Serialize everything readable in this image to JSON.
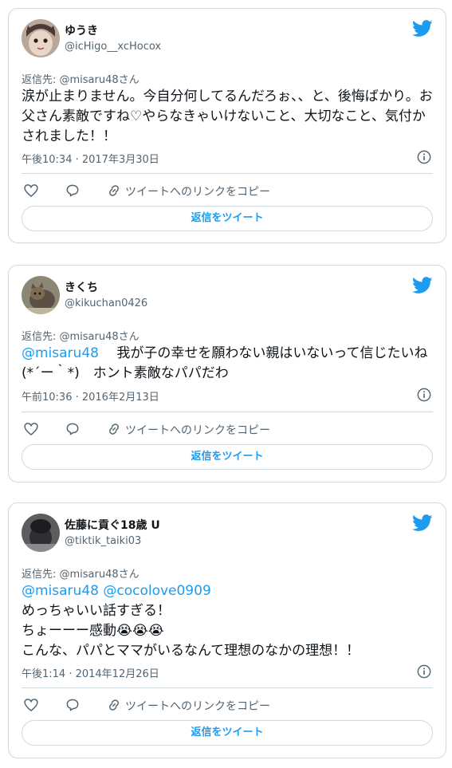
{
  "tweets": [
    {
      "display_name": "ゆうき",
      "handle": "@icHigo__xcHocox",
      "reply_to": "返信先: @misaru48さん",
      "mentions": "",
      "text": "涙が止まりません。今自分何してるんだろぉ、、と、後悔ばかり。お父さん素敵ですね♡やらなきゃいけないこと、大切なこと、気付かされました！！",
      "timestamp": "午後10:34 · 2017年3月30日",
      "copy_link_label": "ツイートへのリンクをコピー",
      "reply_button_label": "返信をツイート"
    },
    {
      "display_name": "きくち",
      "handle": "@kikuchan0426",
      "reply_to": "返信先: @misaru48さん",
      "mentions": "@misaru48",
      "text": "　 我が子の幸せを願わない親はいないって信じたいね(*´ー｀*)　ホント素敵なパパだわ",
      "timestamp": "午前10:36 · 2016年2月13日",
      "copy_link_label": "ツイートへのリンクをコピー",
      "reply_button_label": "返信をツイート"
    },
    {
      "display_name": "佐藤に貢ぐ18歳 U",
      "handle": "@tiktik_taiki03",
      "reply_to": "返信先: @misaru48さん",
      "mentions": "@misaru48 @cocolove0909",
      "text_lines": [
        "めっちゃいい話すぎる！",
        "ちょーーー感動😭😭😭",
        "こんな、パパとママがいるなんて理想のなかの理想！！"
      ],
      "timestamp": "午後1:14 · 2014年12月26日",
      "copy_link_label": "ツイートへのリンクをコピー",
      "reply_button_label": "返信をツイート"
    }
  ],
  "colors": {
    "accent": "#1d9bf0",
    "border": "#cfd9de",
    "muted": "#536471",
    "text": "#0f1419"
  },
  "icons": [
    "twitter-bird-icon",
    "heart-icon",
    "comment-icon",
    "link-icon",
    "info-icon"
  ]
}
